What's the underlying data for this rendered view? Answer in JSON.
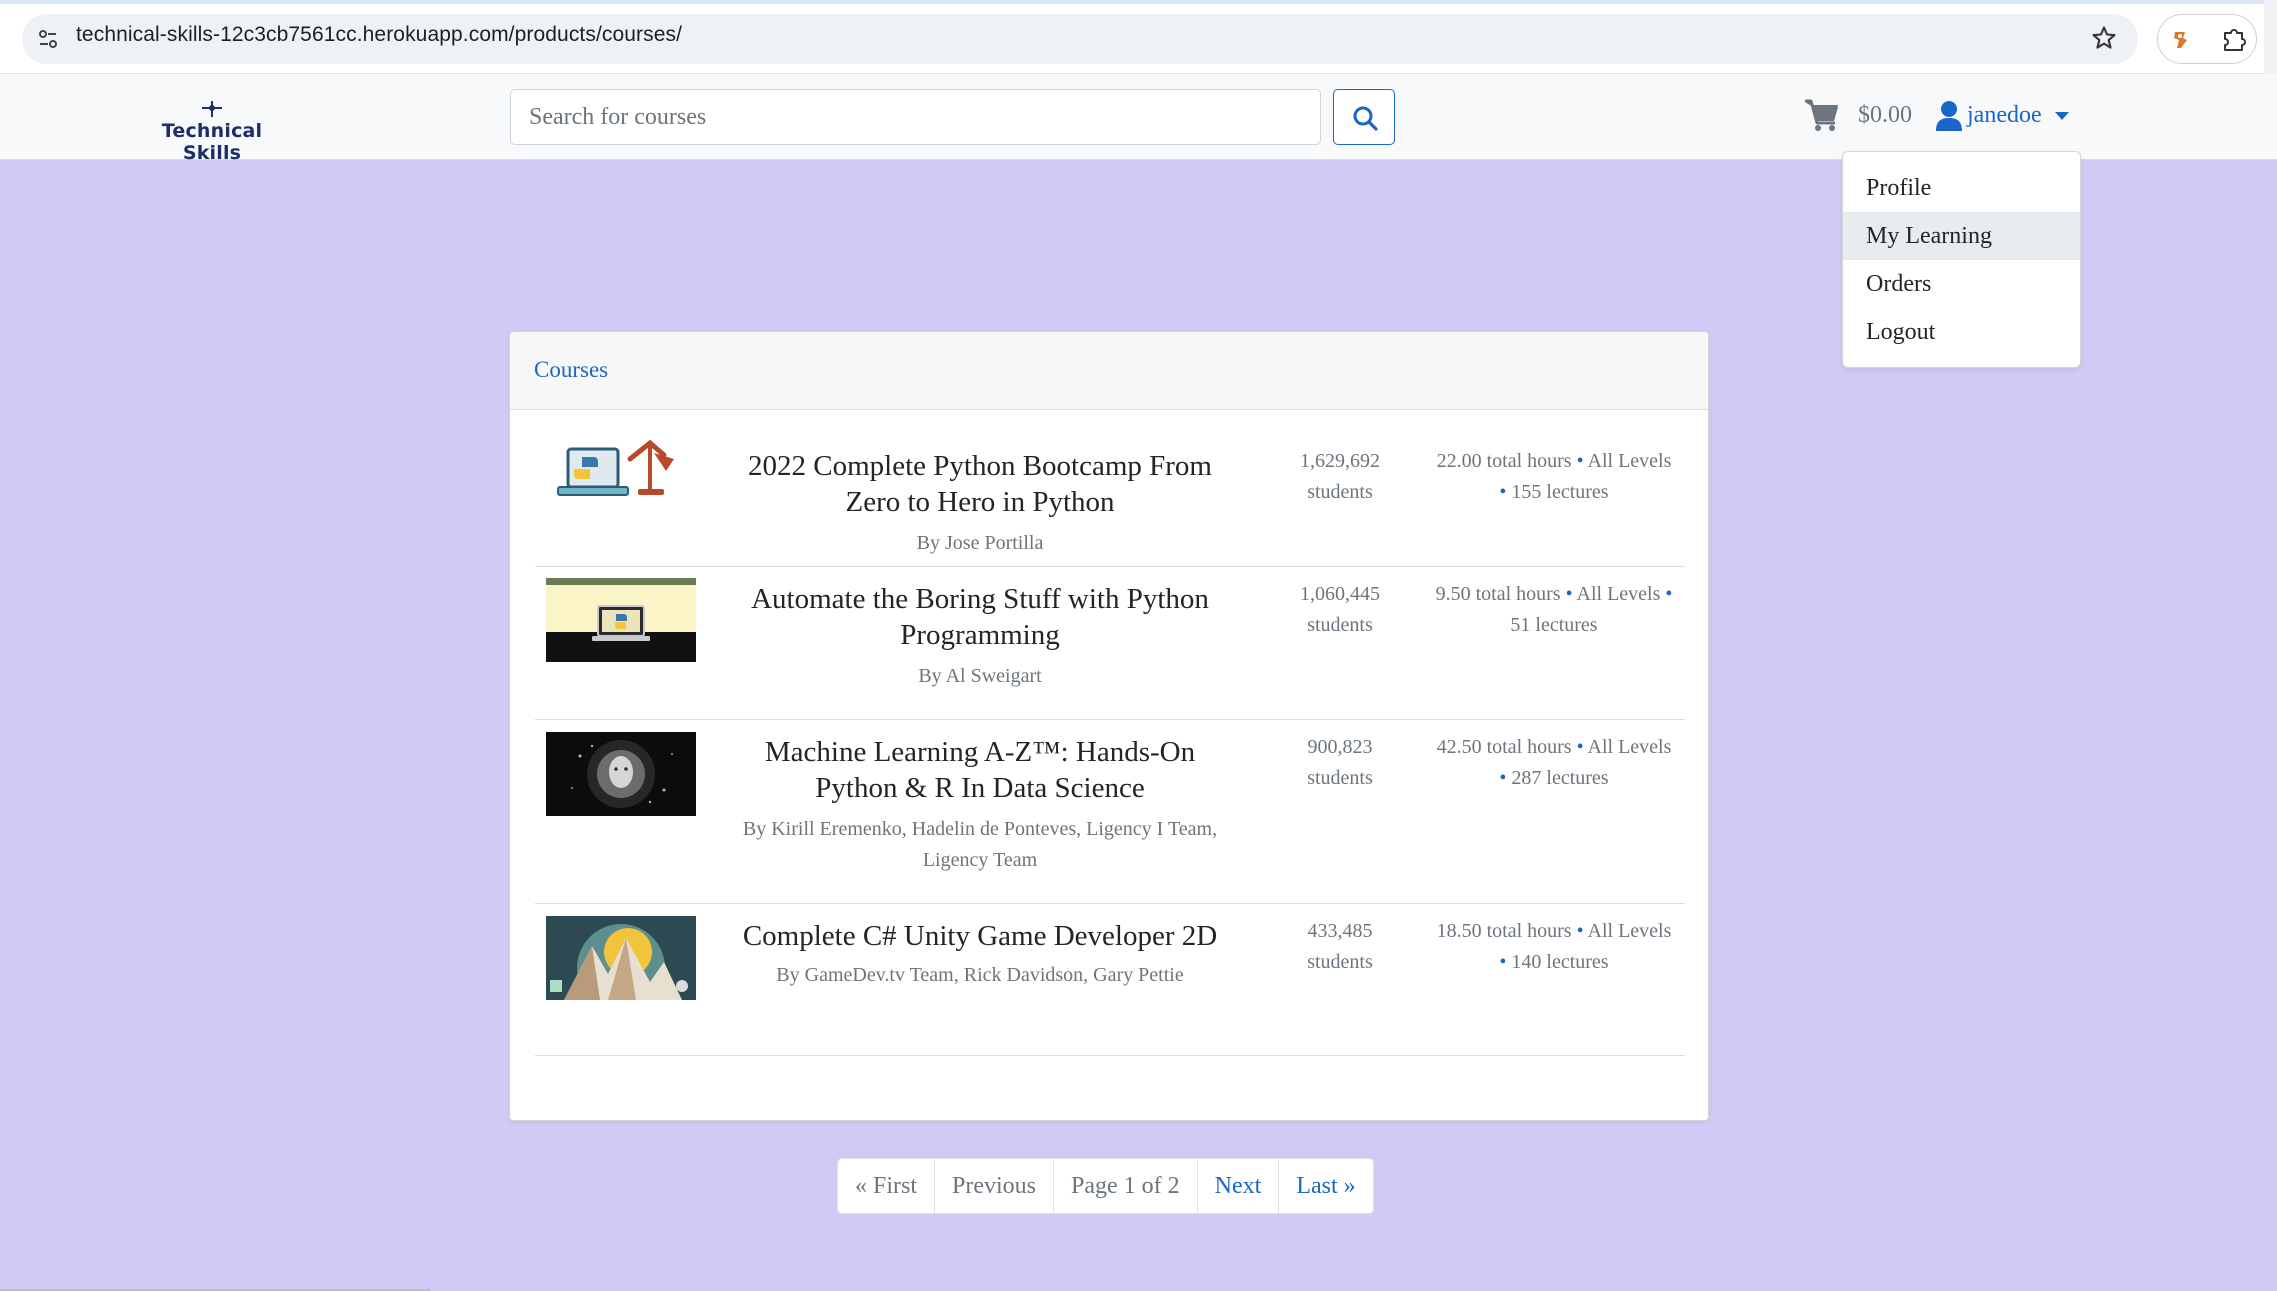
{
  "browser": {
    "url": "technical-skills-12c3cb7561cc.herokuapp.com/products/courses/"
  },
  "navbar": {
    "logo_text": "Technical Skills",
    "search_placeholder": "Search for courses",
    "cart_total": "$0.00",
    "username": "janedoe"
  },
  "dropdown": {
    "items": [
      "Profile",
      "My Learning",
      "Orders",
      "Logout"
    ],
    "active": "My Learning"
  },
  "card": {
    "header": "Courses"
  },
  "courses": [
    {
      "title": "2022 Complete Python Bootcamp From Zero to Hero in Python",
      "author": "By Jose Portilla",
      "students_count": "1,629,692",
      "students_label": "students",
      "hours": "22.00 total hours",
      "level": "All Levels",
      "lectures": "155 lectures",
      "thumbnail": "python-laptop-lamp-image"
    },
    {
      "title": "Automate the Boring Stuff with Python Programming",
      "author": "By Al Sweigart",
      "students_count": "1,060,445",
      "students_label": "students",
      "hours": "9.50 total hours",
      "level": "All Levels",
      "lectures": "51 lectures",
      "thumbnail": "python-monitor-image"
    },
    {
      "title": "Machine Learning A-Z™: Hands-On Python & R In Data Science",
      "author": "By Kirill Eremenko, Hadelin de Ponteves, Ligency I Team, Ligency Team",
      "students_count": "900,823",
      "students_label": "students",
      "hours": "42.50 total hours",
      "level": "All Levels",
      "lectures": "287 lectures",
      "thumbnail": "ai-face-particles-image"
    },
    {
      "title": "Complete C# Unity Game Developer 2D",
      "author": "By GameDev.tv Team, Rick Davidson, Gary Pettie",
      "students_count": "433,485",
      "students_label": "students",
      "hours": "18.50 total hours",
      "level": "All Levels",
      "lectures": "140 lectures",
      "thumbnail": "mountains-sun-image"
    }
  ],
  "pagination": {
    "first": "« First",
    "previous": "Previous",
    "current": "Page 1 of 2",
    "next": "Next",
    "last": "Last »"
  },
  "colors": {
    "page_background": "#d0cbf6",
    "link": "#1a66c8",
    "navbar_background": "#f8f9fa"
  }
}
